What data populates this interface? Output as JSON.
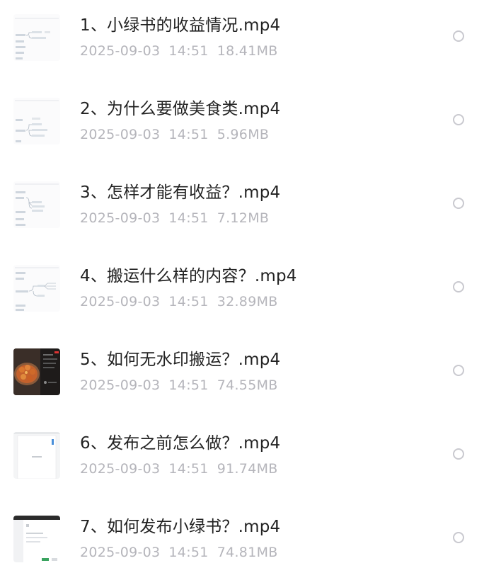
{
  "files": [
    {
      "name": "1、小绿书的收益情况.mp4",
      "date": "2025-09-03",
      "time": "14:51",
      "size": "18.41MB",
      "thumbnail_icon": "mindmap-thumbnail-icon"
    },
    {
      "name": "2、为什么要做美食类.mp4",
      "date": "2025-09-03",
      "time": "14:51",
      "size": "5.96MB",
      "thumbnail_icon": "mindmap-thumbnail-icon"
    },
    {
      "name": "3、怎样才能有收益？.mp4",
      "date": "2025-09-03",
      "time": "14:51",
      "size": "7.12MB",
      "thumbnail_icon": "mindmap-thumbnail-icon"
    },
    {
      "name": "4、搬运什么样的内容？.mp4",
      "date": "2025-09-03",
      "time": "14:51",
      "size": "32.89MB",
      "thumbnail_icon": "mindmap-thumbnail-icon"
    },
    {
      "name": "5、如何无水印搬运？.mp4",
      "date": "2025-09-03",
      "time": "14:51",
      "size": "74.55MB",
      "thumbnail_icon": "food-video-thumbnail-icon"
    },
    {
      "name": "6、发布之前怎么做？.mp4",
      "date": "2025-09-03",
      "time": "14:51",
      "size": "91.74MB",
      "thumbnail_icon": "document-thumbnail-icon"
    },
    {
      "name": "7、如何发布小绿书？.mp4",
      "date": "2025-09-03",
      "time": "14:51",
      "size": "74.81MB",
      "thumbnail_icon": "screen-thumbnail-icon"
    }
  ],
  "colors": {
    "title": "#222222",
    "meta": "#b5b5bb",
    "radio_border": "#c9c9cf"
  }
}
